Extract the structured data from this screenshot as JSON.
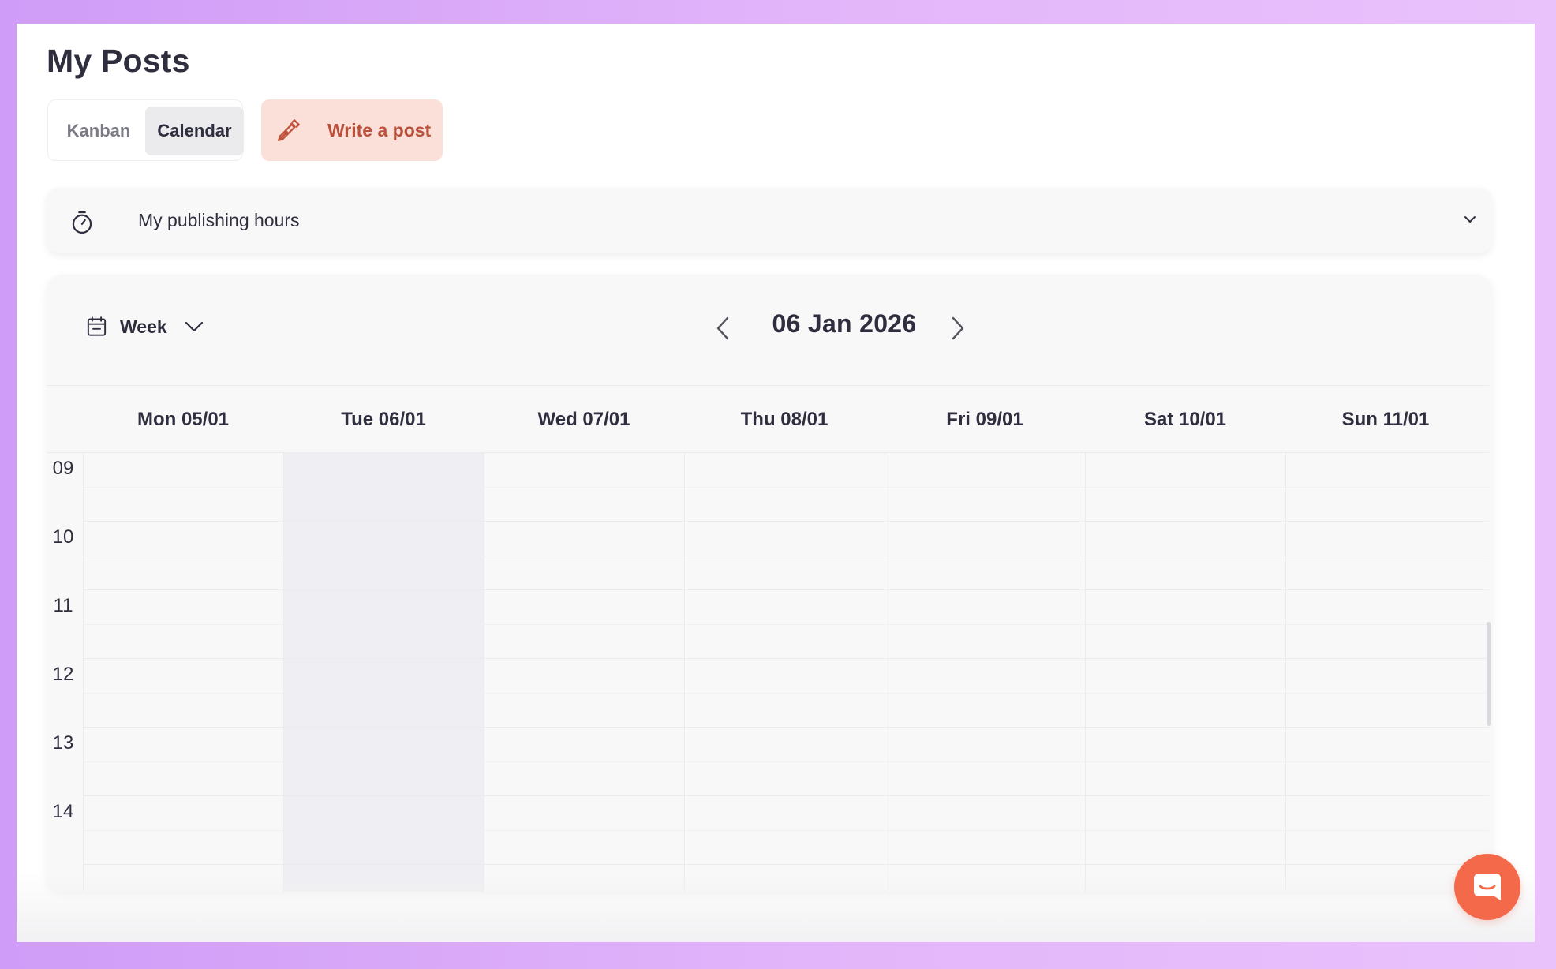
{
  "page": {
    "title": "My Posts"
  },
  "view_toggle": {
    "kanban_label": "Kanban",
    "calendar_label": "Calendar",
    "active": "Calendar"
  },
  "write_button": {
    "label": "Write a post",
    "icon": "pen-icon"
  },
  "publishing_hours": {
    "label": "My publishing hours",
    "icon": "timer-icon",
    "expanded": false
  },
  "calendar": {
    "view_label": "Week",
    "current_date": "06 Jan 2026",
    "days": [
      "Mon 05/01",
      "Tue 06/01",
      "Wed 07/01",
      "Thu 08/01",
      "Fri 09/01",
      "Sat 10/01",
      "Sun 11/01"
    ],
    "today": "Tue 06/01",
    "hours": [
      "09",
      "10",
      "11",
      "12",
      "13",
      "14"
    ]
  },
  "colors": {
    "accent": "#f5694b",
    "write_button_bg": "#fbe0da",
    "write_button_text": "#b8503a",
    "today_column": "#efeff3"
  }
}
